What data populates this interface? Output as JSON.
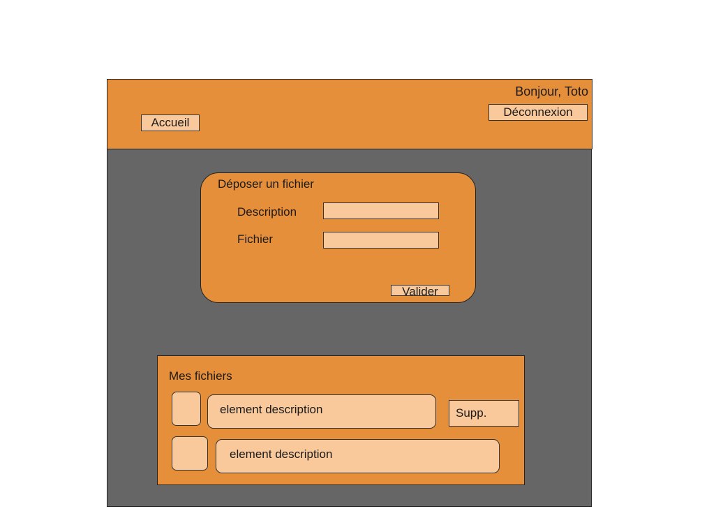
{
  "header": {
    "greeting": "Bonjour, Toto",
    "logout_label": "Déconnexion",
    "home_label": "Accueil"
  },
  "upload_form": {
    "title": "Déposer un fichier",
    "description_label": "Description",
    "description_value": "",
    "file_label": "Fichier",
    "file_value": "",
    "submit_label": "Valider"
  },
  "my_files": {
    "title": "Mes fichiers",
    "items": [
      {
        "description": "element description"
      },
      {
        "description": "element description"
      }
    ],
    "delete_label": "Supp."
  },
  "colors": {
    "background": "#666666",
    "panel": "#e68f3a",
    "control": "#f9c99b"
  }
}
